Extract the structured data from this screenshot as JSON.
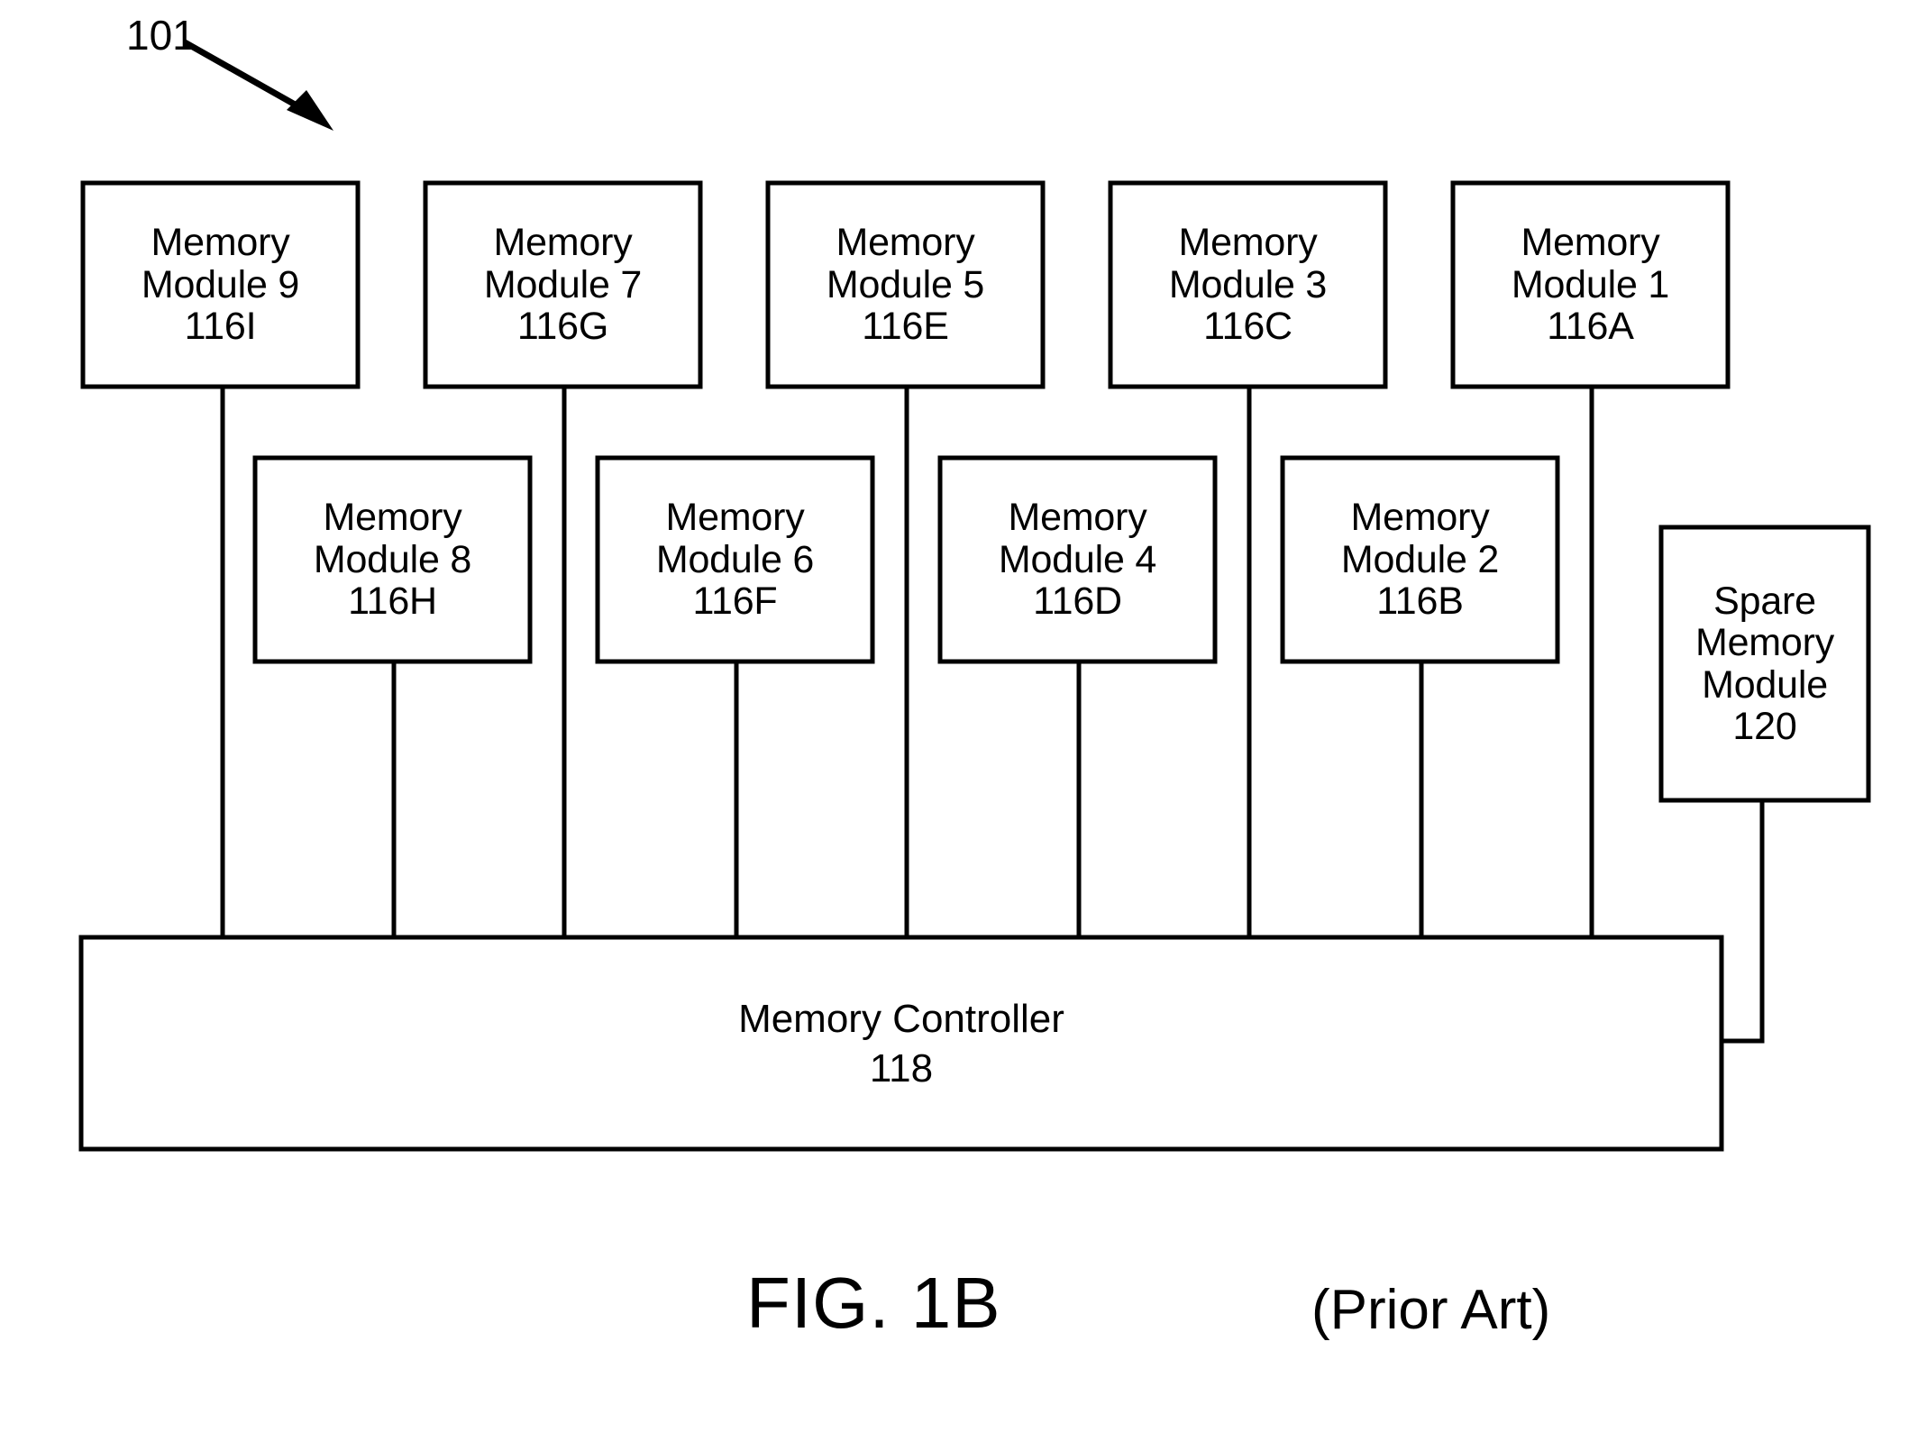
{
  "figure": {
    "reference_numeral": "101",
    "caption": "FIG. 1B",
    "caption_note": "(Prior Art)",
    "ink_color": "#000000",
    "background_color": "#ffffff"
  },
  "top_row_modules": [
    {
      "line1": "Memory",
      "line2": "Module 9",
      "ref": "116I"
    },
    {
      "line1": "Memory",
      "line2": "Module 7",
      "ref": "116G"
    },
    {
      "line1": "Memory",
      "line2": "Module 5",
      "ref": "116E"
    },
    {
      "line1": "Memory",
      "line2": "Module 3",
      "ref": "116C"
    },
    {
      "line1": "Memory",
      "line2": "Module 1",
      "ref": "116A"
    }
  ],
  "bottom_row_modules": [
    {
      "line1": "Memory",
      "line2": "Module 8",
      "ref": "116H"
    },
    {
      "line1": "Memory",
      "line2": "Module 6",
      "ref": "116F"
    },
    {
      "line1": "Memory",
      "line2": "Module 4",
      "ref": "116D"
    },
    {
      "line1": "Memory",
      "line2": "Module 2",
      "ref": "116B"
    }
  ],
  "spare_module": {
    "line1": "Spare",
    "line2": "Memory",
    "line3": "Module",
    "ref": "120"
  },
  "controller": {
    "title": "Memory Controller",
    "ref": "118"
  }
}
